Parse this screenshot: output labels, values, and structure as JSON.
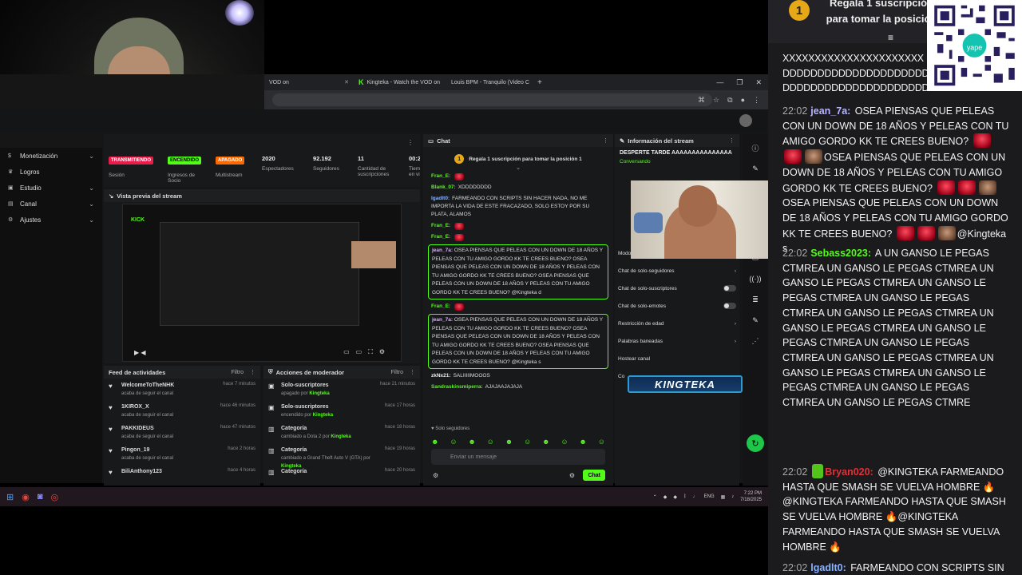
{
  "browser": {
    "tabs": [
      {
        "label": "VOD on"
      },
      {
        "label": "Kingteka - Watch the VOD on"
      },
      {
        "label": "Louis BPM - Tranquilo (Video C"
      }
    ],
    "new_tab": "+",
    "window_controls": [
      "—",
      "❐",
      "✕"
    ]
  },
  "sidebar": {
    "items": [
      {
        "label": "Monetización",
        "icon": "dollar-icon"
      },
      {
        "label": "Logros",
        "icon": "trophy-icon"
      },
      {
        "label": "Estudio",
        "icon": "studio-icon"
      },
      {
        "label": "Canal",
        "icon": "channel-icon"
      },
      {
        "label": "Ajustes",
        "icon": "gear-icon"
      }
    ]
  },
  "stats": {
    "transmitiendo": "TRANSMITIENDO",
    "session_label": "Sesión",
    "encendido": "ENCENDIDO",
    "ingresos_label": "Ingresos de Socio",
    "apagado": "APAGADO",
    "multistream_label": "Multistream",
    "espectadores_value": "2020",
    "espectadores_label": "Espectadores",
    "seguidores_value": "92.192",
    "seguidores_label": "Seguidores",
    "suscripciones_value": "11",
    "suscripciones_label": "Cantidad de suscripciones",
    "tiempo_value": "00:2",
    "tiempo_label": "Tiem en vi",
    "colors": {
      "red": "#e91c4b",
      "green": "#53fc18",
      "orange": "#ff6a00"
    }
  },
  "preview": {
    "title": "Vista previa del stream",
    "brand": "KICK"
  },
  "feed": {
    "title": "Feed de actividades",
    "filter": "Filtro",
    "items": [
      {
        "user": "WelcomeToTheNHK",
        "action": "acaba de seguir el canal",
        "time": "hace 7 minutos"
      },
      {
        "user": "1KIROX_X",
        "action": "acaba de seguir el canal",
        "time": "hace 46 minutos"
      },
      {
        "user": "PAKKIDEUS",
        "action": "acaba de seguir el canal",
        "time": "hace 47 minutos"
      },
      {
        "user": "Pingon_19",
        "action": "acaba de seguir el canal",
        "time": "hace 2 horas"
      },
      {
        "user": "BiliAnthony123",
        "action": "",
        "time": "hace 4 horas"
      }
    ]
  },
  "mod_actions": {
    "title": "Acciones de moderador",
    "filter": "Filtro",
    "items": [
      {
        "title": "Solo-suscriptores",
        "detail": "apagado por",
        "by": "Kingteka",
        "time": "hace 21 minutos"
      },
      {
        "title": "Solo-suscriptores",
        "detail": "encendido por",
        "by": "Kingteka",
        "time": "hace 17 horas"
      },
      {
        "title": "Categoría",
        "detail": "cambiado a Dota 2 por",
        "by": "Kingteka",
        "time": "hace 18 horas"
      },
      {
        "title": "Categoría",
        "detail": "cambiado a Grand Theft Auto V (GTA) por",
        "by": "Kingteka",
        "time": "hace 19 horas"
      },
      {
        "title": "Categoría",
        "detail": "",
        "by": "",
        "time": "hace 20 horas"
      }
    ]
  },
  "chat": {
    "title": "Chat",
    "pinned": "Regala 1 suscripción para tomar la posición 1",
    "messages": [
      {
        "user": "Fran_E:",
        "text": ""
      },
      {
        "user": "Blank_07:",
        "text": "XDDDDDDDD"
      },
      {
        "user": "lgadlt0:",
        "text": "FARMEANDO CON SCRIPTS SIN HACER NADA, NO ME IMPORTA LA VIDA DE ESTE FRACAZADO, SOLO ESTOY POR SU PLATA, ALAMOS"
      },
      {
        "user": "Fran_E:",
        "text": ""
      },
      {
        "user": "Fran_E:",
        "text": ""
      }
    ],
    "highlight1_user": "jean_7a:",
    "highlight1_text": "OSEA PIENSAS QUE PELEAS CON UN DOWN DE 18 AÑOS Y PELEAS CON TU AMIGO GORDO KK TE CREES BUENO? OSEA PIENSAS QUE PELEAS CON UN DOWN DE 18 AÑOS Y PELEAS CON TU AMIGO GORDO KK TE CREES BUENO? OSEA PIENSAS QUE PELEAS CON UN DOWN DE 18 AÑOS Y PELEAS CON TU AMIGO GORDO KK TE CREES BUENO? @Kingteka d",
    "after_fran": "Fran_E:",
    "highlight2_user": "jean_7a:",
    "highlight2_text": "OSEA PIENSAS QUE PELEAS CON UN DOWN DE 18 AÑOS Y PELEAS CON TU AMIGO GORDO KK TE CREES BUENO? OSEA PIENSAS QUE PELEAS CON UN DOWN DE 18 AÑOS Y PELEAS CON TU AMIGO GORDO KK TE CREES BUENO? OSEA PIENSAS QUE PELEAS CON UN DOWN DE 18 AÑOS Y PELEAS CON TU AMIGO GORDO KK TE CREES BUENO? @Kingteka s",
    "tail": [
      {
        "user": "zkNx21:",
        "text": "SALIIIIIMOOOS"
      },
      {
        "user": "Sandraskinsmiperra:",
        "text": "AJAJAAJAJAJA"
      }
    ],
    "solo": "Solo seguidores",
    "placeholder": "Enviar un mensaje",
    "send": "Chat"
  },
  "info": {
    "title": "Información del stream",
    "stream_title": "DESPERTE TARDE AAAAAAAAAAAAAAA",
    "category": "Conversando",
    "options": [
      {
        "label": "Modo lento",
        "type": "chevron"
      },
      {
        "label": "Chat de solo-seguidores",
        "type": "chevron"
      },
      {
        "label": "Chat de solo-suscriptores",
        "type": "toggle"
      },
      {
        "label": "Chat de solo-emotes",
        "type": "toggle"
      },
      {
        "label": "Restricción de edad",
        "type": "chevron"
      },
      {
        "label": "Palabras baneadas",
        "type": "chevron"
      },
      {
        "label": "Hostear canal",
        "type": "none"
      },
      {
        "label": "Co",
        "type": "none"
      }
    ],
    "logo": "KINGTEKA"
  },
  "taskbar": {
    "time": "7:22 PM",
    "date": "7/18/2025",
    "lang": "ENG"
  },
  "overlay": {
    "pin_number": "1",
    "pin_text": "Regala 1 suscripción para tomar la posición",
    "messages": [
      {
        "time": "",
        "user": "",
        "text": "XXXXXXXXXXXXXXXXXXXXXX DDDDDDDDDDDDDDDDDDDDDD DDDDDDDDDDDDDDDDDDDDDD"
      },
      {
        "time": "22:02",
        "user": "jean_7a:",
        "text": "OSEA PIENSAS QUE PELEAS CON UN DOWN DE 18 AÑOS Y PELEAS CON TU AMIGO GORDO KK TE CREES BUENO?"
      },
      {
        "time": "",
        "user": "",
        "text": "OSEA PIENSAS QUE PELEAS CON UN DOWN DE 18 AÑOS Y PELEAS CON TU AMIGO GORDO KK TE CREES BUENO?"
      },
      {
        "time": "",
        "user": "",
        "text": "OSEA PIENSAS QUE PELEAS CON UN DOWN DE 18 AÑOS Y PELEAS CON TU AMIGO GORDO KK TE CREES BUENO?"
      },
      {
        "time": "",
        "user": "",
        "text": "@Kingteka s"
      },
      {
        "time": "22:02",
        "user": "Sebass2023:",
        "text": "A UN GANSO LE PEGAS CTMREA UN GANSO LE PEGAS CTMREA UN GANSO LE PEGAS CTMREA UN GANSO LE PEGAS CTMREA UN GANSO LE PEGAS CTMREA UN GANSO LE PEGAS CTMREA UN GANSO LE PEGAS CTMREA UN GANSO LE PEGAS CTMREA UN GANSO LE PEGAS CTMREA UN GANSO LE PEGAS CTMREA UN GANSO LE PEGAS CTMREA UN GANSO LE PEGAS CTMREA UN GANSO LE PEGAS CTMREA UN GANSO LE PEGAS CTMRE"
      },
      {
        "time": "22:02",
        "user": "Bryan020:",
        "text": "@KINGTEKA FARMEANDO HASTA QUE SMASH SE VUELVA HOMBRE"
      },
      {
        "time": "",
        "user": "",
        "text": "@KINGTEKA FARMEANDO HASTA QUE SMASH SE VUELVA HOMBRE"
      },
      {
        "time": "",
        "user": "",
        "text": "@KINGTEKA FARMEANDO HASTA QUE SMASH SE VUELVA HOMBRE"
      },
      {
        "time": "22:02",
        "user": "lgadlt0:",
        "text": "FARMEANDO CON SCRIPTS SIN"
      }
    ],
    "colors": {
      "jean": "#b9b5ff",
      "sebass": "#53fc18",
      "bryan": "#e0303a",
      "lgad": "#8ab4ff"
    },
    "qr_label": "yape"
  }
}
